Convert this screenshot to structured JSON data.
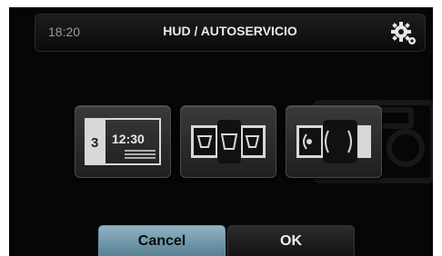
{
  "header": {
    "time": "18:20",
    "title": "HUD / AUTOSERVICIO",
    "settings_icon": "gear-icon"
  },
  "modes": [
    {
      "name": "schedule-mode",
      "icon": "clock-schedule-icon",
      "number": "3",
      "time": "12:30"
    },
    {
      "name": "multi-bin-mode",
      "icon": "bins-icon"
    },
    {
      "name": "roll-mode",
      "icon": "roll-icon"
    }
  ],
  "footer": {
    "cancel_label": "Cancel",
    "ok_label": "OK"
  },
  "colors": {
    "cancel_accent": "#6e97a8",
    "background": "#060606"
  }
}
